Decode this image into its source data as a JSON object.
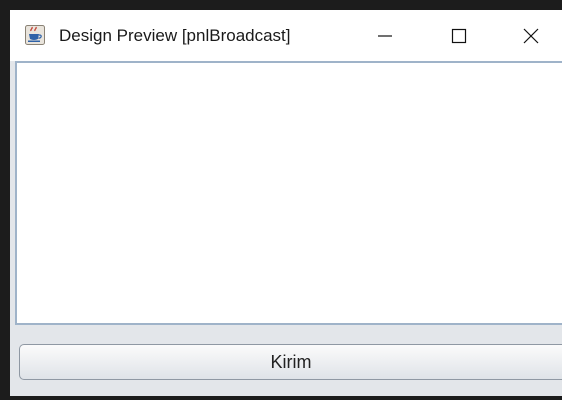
{
  "window": {
    "title": "Design Preview [pnlBroadcast]",
    "app_icon": "java-coffee-cup-icon",
    "controls": {
      "minimize_icon": "minimize-icon",
      "maximize_icon": "maximize-icon",
      "close_icon": "close-icon"
    }
  },
  "main": {
    "text_area_value": "",
    "send_button_label": "Kirim"
  },
  "colors": {
    "text_area_border": "#9fb3c9",
    "panel_background": "#e3e6ea"
  }
}
